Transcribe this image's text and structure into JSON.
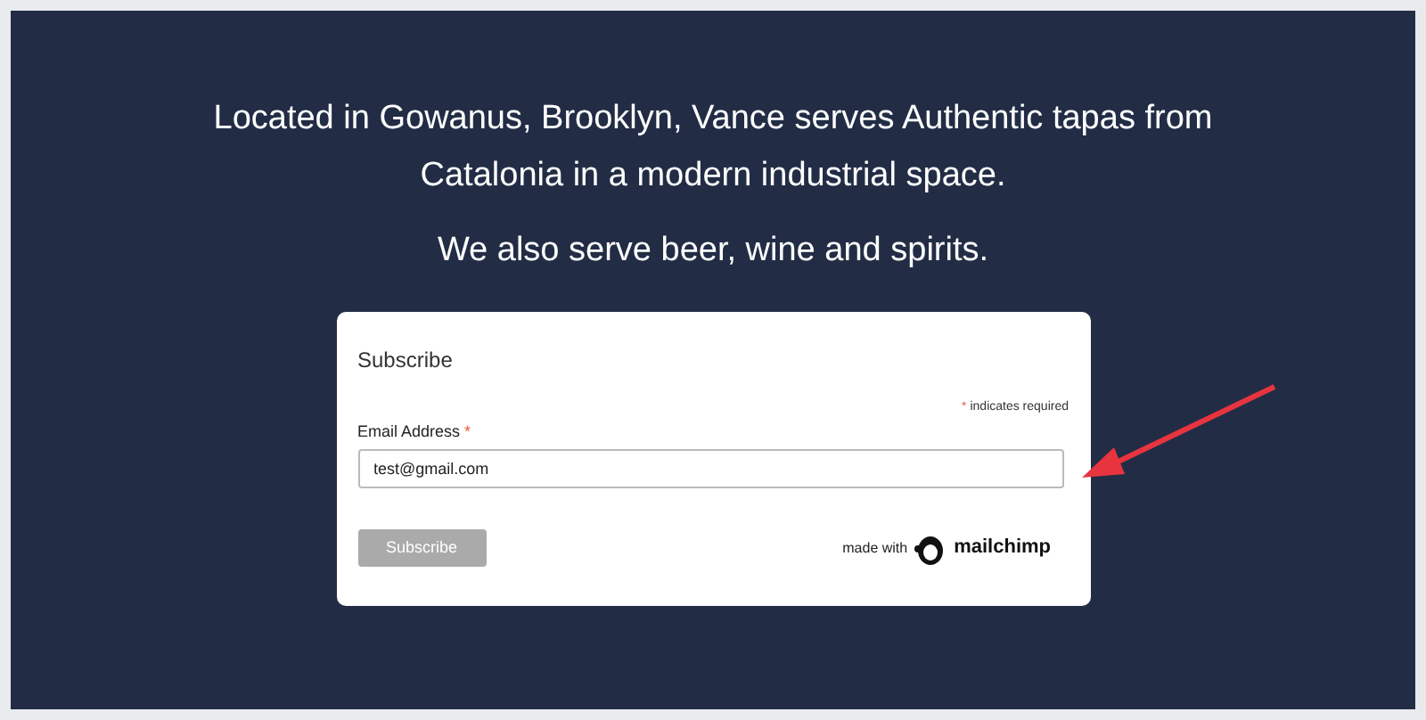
{
  "intro": {
    "paragraphs": [
      "Located in Gowanus, Brooklyn, Vance serves Authentic tapas from Catalonia in a modern industrial space.",
      "We also serve beer, wine and spirits."
    ]
  },
  "form": {
    "title": "Subscribe",
    "required_note": {
      "mark": "*",
      "text": "indicates required"
    },
    "email": {
      "label": "Email Address",
      "required_mark": "*",
      "value": "test@gmail.com"
    },
    "submit": {
      "label": "Subscribe",
      "disabled": true
    },
    "badge": {
      "prefix": "made with",
      "brand": "mailchimp"
    }
  }
}
